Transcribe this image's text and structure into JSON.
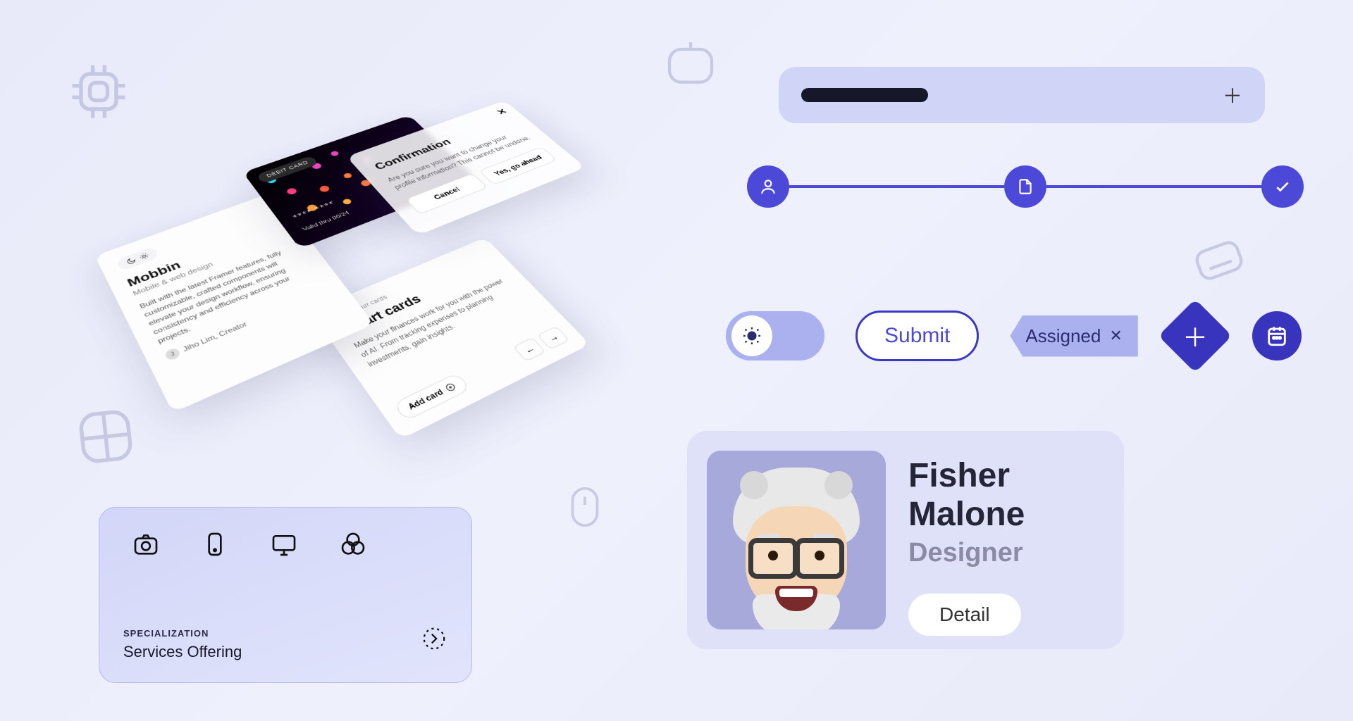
{
  "mobbin": {
    "title": "Mobbin",
    "subtitle": "Mobile & web design",
    "body": "Built with the latest Framer features, fully customizable, crafted components will elevate your design workflow, ensuring consistency and efficiency across your projects.",
    "author": "Jiho Lim, Creator"
  },
  "debit": {
    "label": "DEBIT CARD",
    "number": "**** ****",
    "valid": "Valid thru 06/24"
  },
  "confirm": {
    "title": "Confirmation",
    "body": "Are you sure you want to change your profile information? This cannot be undone.",
    "cancel": "Cancel",
    "ok": "Yes, go ahead"
  },
  "smart": {
    "category": "All your cards",
    "title": "Smart cards",
    "body": "Make your finances work for you with the power of AI. From tracking expenses to planning investments, gain insights.",
    "add": "Add card"
  },
  "controls": {
    "submit": "Submit",
    "tag": "Assigned"
  },
  "profile": {
    "name": "Fisher Malone",
    "role": "Designer",
    "detail": "Detail"
  },
  "spec": {
    "label": "SPECIALIZATION",
    "title": "Services Offering"
  }
}
